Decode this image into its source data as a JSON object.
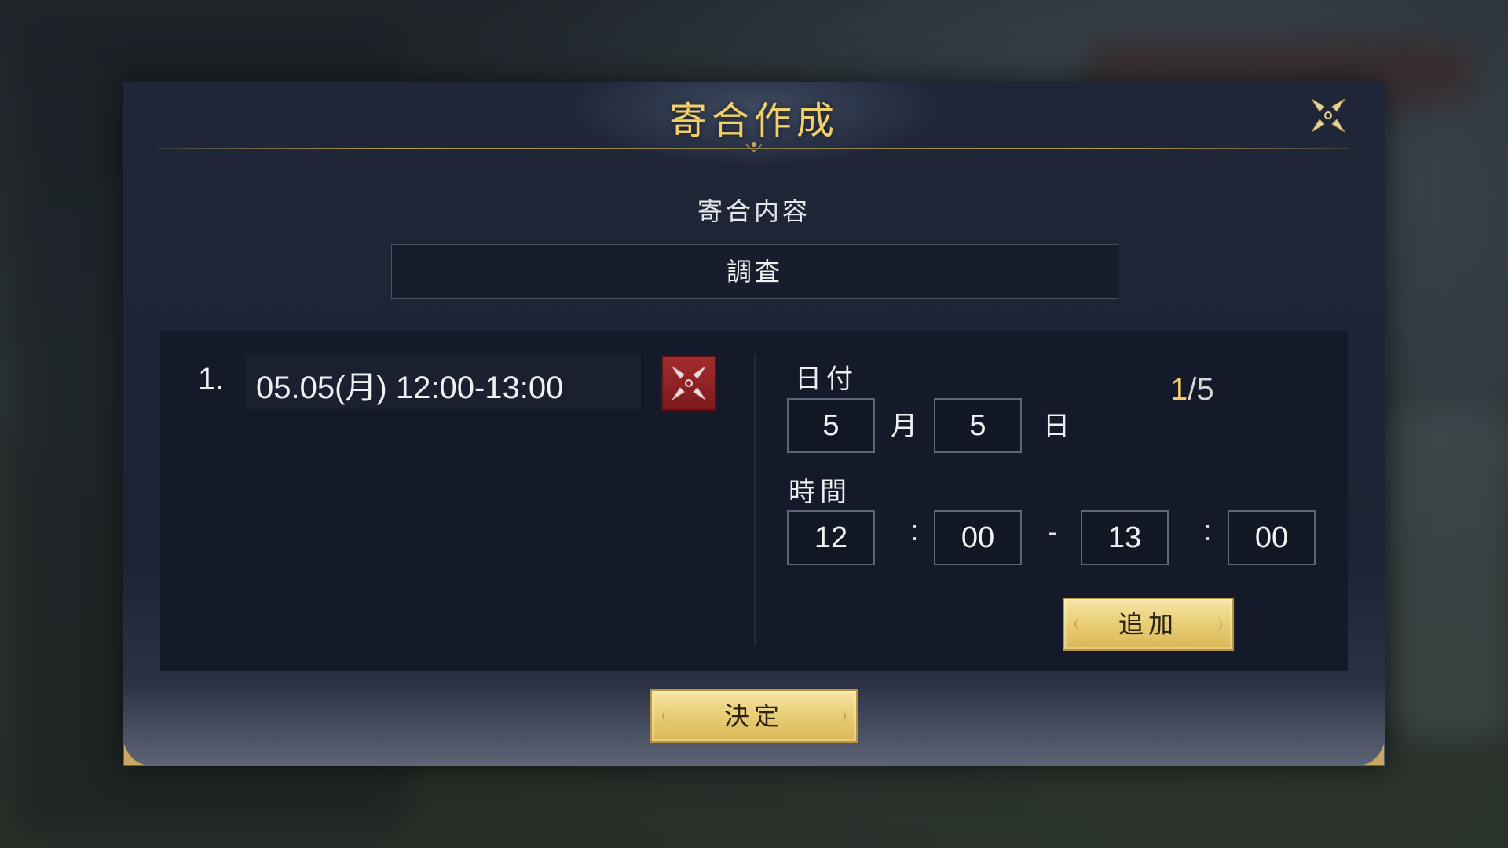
{
  "dialog": {
    "title": "寄合作成",
    "content_label": "寄合内容",
    "content_value": "調査"
  },
  "entries": [
    {
      "index": "1.",
      "text": "05.05(月) 12:00-13:00"
    }
  ],
  "date": {
    "label": "日付",
    "month_value": "5",
    "month_unit": "月",
    "day_value": "5",
    "day_unit": "日"
  },
  "time": {
    "label": "時間",
    "start_hour": "12",
    "start_minute": "00",
    "end_hour": "13",
    "end_minute": "00",
    "colon": ":",
    "dash": "-"
  },
  "add_button": "追加",
  "count": {
    "current": "1",
    "separator": "/",
    "max": "5"
  },
  "confirm_button": "決定",
  "colors": {
    "title_gold": "#f1cf6a",
    "button_gold": "#e9cd74",
    "delete_red": "#a12c2c",
    "panel_bg": "#141a29"
  }
}
